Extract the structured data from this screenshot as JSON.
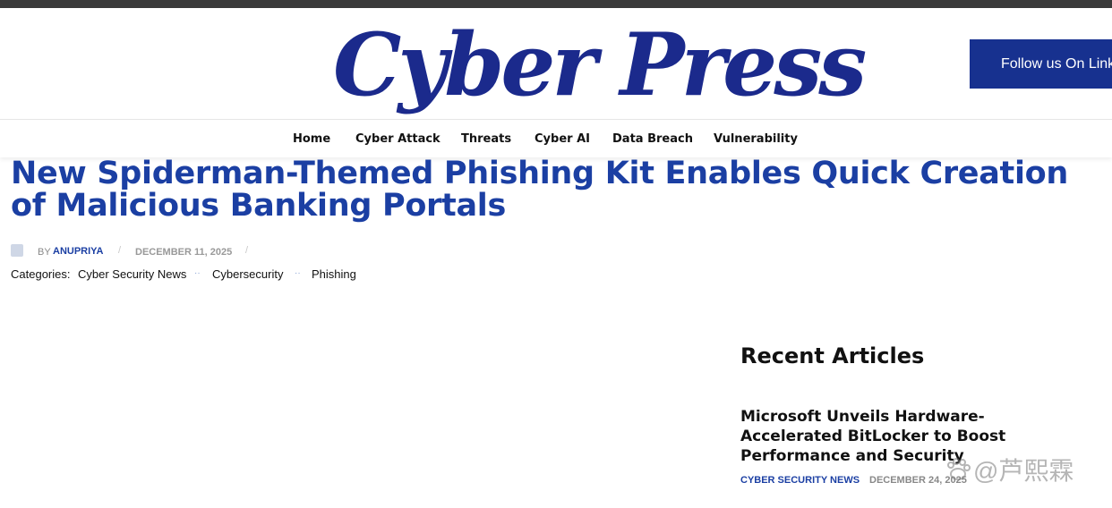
{
  "header": {
    "logo_text": "Cyber Press",
    "follow_label": "Follow us On Linke"
  },
  "nav": {
    "items": [
      "Home",
      "Cyber Attack",
      "Threats",
      "Cyber AI",
      "Data Breach",
      "Vulnerability"
    ]
  },
  "article": {
    "title": "New Spiderman-Themed Phishing Kit Enables Quick Creation of Malicious Banking Portals",
    "by_label": "BY",
    "author": "ANUPRIYA",
    "separator": "/",
    "date": "DECEMBER 11, 2025",
    "categories_label": "Categories:",
    "categories": [
      "Cyber Security News",
      "Cybersecurity",
      "Phishing"
    ],
    "category_separator": "··"
  },
  "sidebar": {
    "title": "Recent Articles",
    "articles": [
      {
        "title": "Microsoft Unveils Hardware-Accelerated BitLocker to Boost Performance and Security",
        "category": "CYBER SECURITY NEWS",
        "date": "DECEMBER 24, 2025"
      }
    ]
  },
  "watermark": {
    "text": "@芦熙霖"
  },
  "colors": {
    "brand": "#1b2a8c",
    "accent": "#1b3fa3",
    "follow_bg": "#17318f",
    "top_bar": "#3a3a3a"
  }
}
